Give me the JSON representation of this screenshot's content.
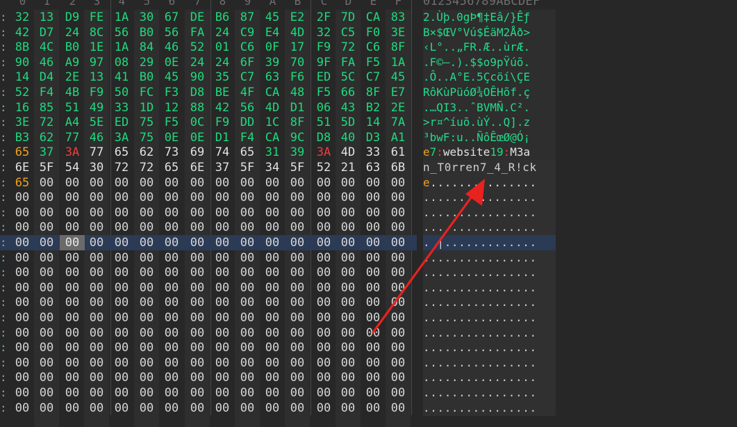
{
  "header": {
    "offsets": [
      "0",
      "1",
      "2",
      "3",
      "4",
      "5",
      "6",
      "7",
      "8",
      "9",
      "A",
      "B",
      "C",
      "D",
      "E",
      "F"
    ],
    "ascii_header": "0123456789ABCDEF"
  },
  "hex_rows": [
    {
      "bytes": [
        "32",
        "13",
        "D9",
        "FE",
        "1A",
        "30",
        "67",
        "DE",
        "B6",
        "87",
        "45",
        "E2",
        "2F",
        "7D",
        "CA",
        "83"
      ],
      "ascii": "2.Ùþ.0gÞ¶‡Eâ/}Êƒ"
    },
    {
      "bytes": [
        "42",
        "D7",
        "24",
        "8C",
        "56",
        "B0",
        "56",
        "FA",
        "24",
        "C9",
        "E4",
        "4D",
        "32",
        "C5",
        "F0",
        "3E"
      ],
      "ascii": "B×$ŒV°Vú$ÉäM2Åð>"
    },
    {
      "bytes": [
        "8B",
        "4C",
        "B0",
        "1E",
        "1A",
        "84",
        "46",
        "52",
        "01",
        "C6",
        "0F",
        "17",
        "F9",
        "72",
        "C6",
        "8F"
      ],
      "ascii": "‹L°..„FR.Æ..ùrÆ."
    },
    {
      "bytes": [
        "90",
        "46",
        "A9",
        "97",
        "08",
        "29",
        "0E",
        "24",
        "24",
        "6F",
        "39",
        "70",
        "9F",
        "FA",
        "F5",
        "1A"
      ],
      "ascii": ".F©—.).$$o9pŸúõ."
    },
    {
      "bytes": [
        "14",
        "D4",
        "2E",
        "13",
        "41",
        "B0",
        "45",
        "90",
        "35",
        "C7",
        "63",
        "F6",
        "ED",
        "5C",
        "C7",
        "45"
      ],
      "ascii": ".Ô..A°E.5Çcöí\\ÇE"
    },
    {
      "bytes": [
        "52",
        "F4",
        "4B",
        "F9",
        "50",
        "FC",
        "F3",
        "D8",
        "BE",
        "4F",
        "CA",
        "48",
        "F5",
        "66",
        "8F",
        "E7"
      ],
      "ascii": "RôKùPüóØ¾OÊHõf.ç"
    },
    {
      "bytes": [
        "16",
        "85",
        "51",
        "49",
        "33",
        "1D",
        "12",
        "88",
        "42",
        "56",
        "4D",
        "D1",
        "06",
        "43",
        "B2",
        "2E"
      ],
      "ascii": ".…QI3..ˆBVMÑ.C²."
    },
    {
      "bytes": [
        "3E",
        "72",
        "A4",
        "5E",
        "ED",
        "75",
        "F5",
        "0C",
        "F9",
        "DD",
        "1C",
        "8F",
        "51",
        "5D",
        "14",
        "7A"
      ],
      "ascii": ">r¤^íuõ.ùÝ..Q].z"
    },
    {
      "bytes": [
        "B3",
        "62",
        "77",
        "46",
        "3A",
        "75",
        "0E",
        "0E",
        "D1",
        "F4",
        "CA",
        "9C",
        "D8",
        "40",
        "D3",
        "A1"
      ],
      "ascii": "³bwF:u..ÑôÊœØ@Ó¡"
    },
    {
      "bytes": [
        "65",
        "37",
        "3A",
        "77",
        "65",
        "62",
        "73",
        "69",
        "74",
        "65",
        "31",
        "39",
        "3A",
        "4D",
        "33",
        "61"
      ]
    },
    {
      "bytes": [
        "6E",
        "5F",
        "54",
        "30",
        "72",
        "72",
        "65",
        "6E",
        "37",
        "5F",
        "34",
        "5F",
        "52",
        "21",
        "63",
        "6B"
      ],
      "ascii": "n_T0rren7_4_R!ck"
    },
    {
      "bytes": [
        "65",
        "00",
        "00",
        "00",
        "00",
        "00",
        "00",
        "00",
        "00",
        "00",
        "00",
        "00",
        "00",
        "00",
        "00",
        "00"
      ]
    },
    {
      "bytes": [
        "00",
        "00",
        "00",
        "00",
        "00",
        "00",
        "00",
        "00",
        "00",
        "00",
        "00",
        "00",
        "00",
        "00",
        "00",
        "00"
      ],
      "ascii": "................"
    },
    {
      "bytes": [
        "00",
        "00",
        "00",
        "00",
        "00",
        "00",
        "00",
        "00",
        "00",
        "00",
        "00",
        "00",
        "00",
        "00",
        "00",
        "00"
      ],
      "ascii": "................"
    },
    {
      "bytes": [
        "00",
        "00",
        "00",
        "00",
        "00",
        "00",
        "00",
        "00",
        "00",
        "00",
        "00",
        "00",
        "00",
        "00",
        "00",
        "00"
      ],
      "ascii": "................"
    },
    {
      "bytes": [
        "00",
        "00",
        "00",
        "00",
        "00",
        "00",
        "00",
        "00",
        "00",
        "00",
        "00",
        "00",
        "00",
        "00",
        "00",
        "00"
      ],
      "ascii": ". |.............",
      "selected": true
    },
    {
      "bytes": [
        "00",
        "00",
        "00",
        "00",
        "00",
        "00",
        "00",
        "00",
        "00",
        "00",
        "00",
        "00",
        "00",
        "00",
        "00",
        "00"
      ],
      "ascii": "................"
    },
    {
      "bytes": [
        "00",
        "00",
        "00",
        "00",
        "00",
        "00",
        "00",
        "00",
        "00",
        "00",
        "00",
        "00",
        "00",
        "00",
        "00",
        "00"
      ],
      "ascii": "................"
    },
    {
      "bytes": [
        "00",
        "00",
        "00",
        "00",
        "00",
        "00",
        "00",
        "00",
        "00",
        "00",
        "00",
        "00",
        "00",
        "00",
        "00",
        "00"
      ],
      "ascii": "................"
    },
    {
      "bytes": [
        "00",
        "00",
        "00",
        "00",
        "00",
        "00",
        "00",
        "00",
        "00",
        "00",
        "00",
        "00",
        "00",
        "00",
        "00",
        "00"
      ],
      "ascii": "................"
    },
    {
      "bytes": [
        "00",
        "00",
        "00",
        "00",
        "00",
        "00",
        "00",
        "00",
        "00",
        "00",
        "00",
        "00",
        "00",
        "00",
        "00",
        "00"
      ],
      "ascii": "................"
    },
    {
      "bytes": [
        "00",
        "00",
        "00",
        "00",
        "00",
        "00",
        "00",
        "00",
        "00",
        "00",
        "00",
        "00",
        "00",
        "00",
        "00",
        "00"
      ],
      "ascii": "................"
    },
    {
      "bytes": [
        "00",
        "00",
        "00",
        "00",
        "00",
        "00",
        "00",
        "00",
        "00",
        "00",
        "00",
        "00",
        "00",
        "00",
        "00",
        "00"
      ],
      "ascii": "................"
    },
    {
      "bytes": [
        "00",
        "00",
        "00",
        "00",
        "00",
        "00",
        "00",
        "00",
        "00",
        "00",
        "00",
        "00",
        "00",
        "00",
        "00",
        "00"
      ],
      "ascii": "................"
    },
    {
      "bytes": [
        "00",
        "00",
        "00",
        "00",
        "00",
        "00",
        "00",
        "00",
        "00",
        "00",
        "00",
        "00",
        "00",
        "00",
        "00",
        "00"
      ],
      "ascii": "................"
    },
    {
      "bytes": [
        "00",
        "00",
        "00",
        "00",
        "00",
        "00",
        "00",
        "00",
        "00",
        "00",
        "00",
        "00",
        "00",
        "00",
        "00",
        "00"
      ],
      "ascii": "................"
    },
    {
      "bytes": [
        "00",
        "00",
        "00",
        "00",
        "00",
        "00",
        "00",
        "00",
        "00",
        "00",
        "00",
        "00",
        "00",
        "00",
        "00",
        "00"
      ],
      "ascii": "................"
    }
  ],
  "ascii_special": {
    "row9": [
      {
        "t": "e",
        "c": "o"
      },
      {
        "t": "7",
        "c": "g"
      },
      {
        "t": ":",
        "c": "r"
      },
      {
        "t": "website",
        "c": "w"
      },
      {
        "t": "19",
        "c": "g"
      },
      {
        "t": ":",
        "c": "r"
      },
      {
        "t": "M3a",
        "c": "w"
      }
    ],
    "row11": [
      {
        "t": "e",
        "c": "o"
      },
      {
        "t": "...............",
        "c": "w"
      }
    ]
  },
  "hex_colors": {
    "row9": [
      "o",
      "g",
      "r",
      "w",
      "w",
      "w",
      "w",
      "w",
      "w",
      "w",
      "g",
      "g",
      "r",
      "w",
      "w",
      "w"
    ],
    "row11": [
      "o",
      "z",
      "z",
      "z",
      "z",
      "z",
      "z",
      "z",
      "z",
      "z",
      "z",
      "z",
      "z",
      "z",
      "z",
      "z"
    ]
  },
  "cursor": {
    "row": 15,
    "col": 2
  },
  "colors": {
    "background": "#272727",
    "hex_green": "#20d97d",
    "accent_orange": "#f0a21c",
    "accent_red": "#ef3d3d",
    "selection_row": "#2b3a55",
    "annotation_arrow": "#e8221f"
  },
  "annotation": {
    "type": "arrow",
    "icon": "red-arrow-annotation"
  }
}
